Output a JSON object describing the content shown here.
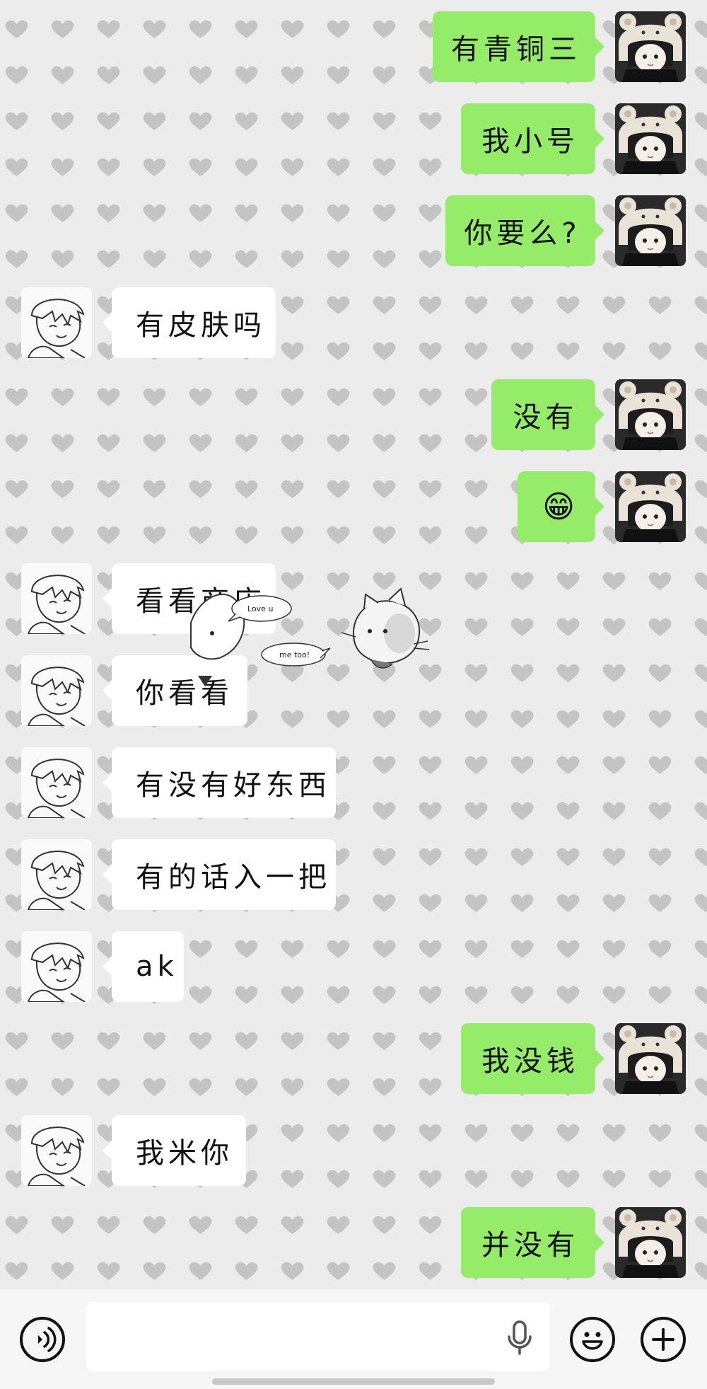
{
  "messages": [
    {
      "side": "out",
      "text": "有青铜三"
    },
    {
      "side": "out",
      "text": "我小号"
    },
    {
      "side": "out",
      "text": "你要么?"
    },
    {
      "side": "in",
      "text": "有皮肤吗"
    },
    {
      "side": "out",
      "text": "没有"
    },
    {
      "side": "out",
      "text": "😁"
    },
    {
      "side": "in",
      "text": "看看商店"
    },
    {
      "side": "in",
      "text": "你看看"
    },
    {
      "side": "in",
      "text": "有没有好东西"
    },
    {
      "side": "in",
      "text": "有的话入一把"
    },
    {
      "side": "in",
      "text": "ak"
    },
    {
      "side": "out",
      "text": "我没钱"
    },
    {
      "side": "in",
      "text": "我米你"
    },
    {
      "side": "out",
      "text": "并没有"
    }
  ],
  "sticker": {
    "bubble1": "Love u",
    "bubble2": "me too!"
  },
  "input": {
    "value": "",
    "placeholder": ""
  },
  "colors": {
    "outgoing_bubble": "#95ec69",
    "incoming_bubble": "#ffffff",
    "background": "#ececec"
  },
  "icons": [
    "voice-icon",
    "mic-icon",
    "emoji-icon",
    "plus-icon"
  ]
}
